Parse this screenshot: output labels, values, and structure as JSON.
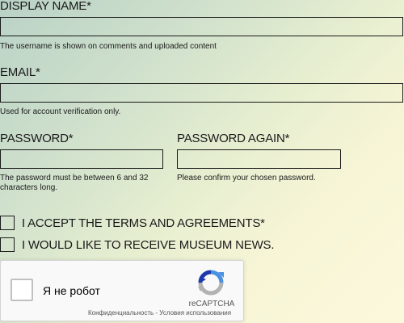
{
  "form": {
    "display_name": {
      "label": "DISPLAY NAME*",
      "value": "",
      "help": "The username is shown on comments and uploaded content"
    },
    "email": {
      "label": "EMAIL*",
      "value": "",
      "help": "Used for account verification only."
    },
    "password": {
      "label": "PASSWORD*",
      "value": "",
      "help": "The password must be between 6 and 32 characters long."
    },
    "password_again": {
      "label": "PASSWORD AGAIN*",
      "value": "",
      "help": "Please confirm your chosen password."
    },
    "accept_terms": {
      "label": "I ACCEPT THE TERMS AND AGREEMENTS*",
      "checked": false
    },
    "museum_news": {
      "label": "I WOULD LIKE TO RECEIVE MUSEUM NEWS.",
      "checked": false
    }
  },
  "recaptcha": {
    "checkbox_label": "Я не робот",
    "brand": "reCAPTCHA",
    "privacy_link": "Конфиденциальность",
    "separator": " - ",
    "terms_link": "Условия использования",
    "logo_icon": "recaptcha-logo-icon",
    "colors": {
      "blue": "#4a90e2",
      "dark_blue": "#1c3aa9",
      "grey": "#b2b2b2"
    }
  },
  "colors": {
    "text": "#1a1a1a",
    "gradient_start": "#b9d2c6",
    "gradient_end": "#fcf8dc"
  }
}
